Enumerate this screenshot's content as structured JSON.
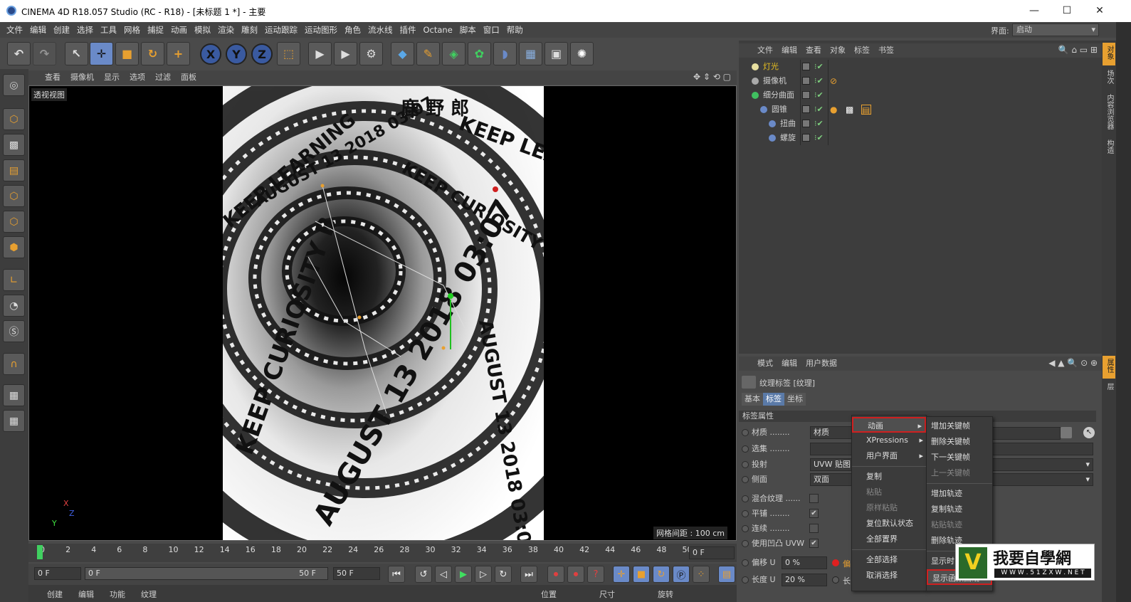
{
  "window": {
    "title": "CINEMA 4D R18.057 Studio (RC - R18) - [未标题 1 *] - 主要",
    "minimize": "—",
    "maximize": "☐",
    "close": "✕"
  },
  "menu": [
    "文件",
    "编辑",
    "创建",
    "选择",
    "工具",
    "网格",
    "捕捉",
    "动画",
    "模拟",
    "渲染",
    "雕刻",
    "运动跟踪",
    "运动图形",
    "角色",
    "流水线",
    "插件",
    "Octane",
    "脚本",
    "窗口",
    "帮助"
  ],
  "layout": {
    "label": "界面:",
    "value": "启动"
  },
  "toolbar": {
    "x": "X",
    "y": "Y",
    "z": "Z"
  },
  "viewport": {
    "menu": [
      "查看",
      "摄像机",
      "显示",
      "选项",
      "过滤",
      "面板"
    ],
    "label": "透视视图",
    "grid": "网格间距 : 100 cm",
    "axis": {
      "x": "X",
      "y": "Y",
      "z": "Z"
    }
  },
  "scene_text": {
    "lines": [
      "KEEP LEARNING",
      "AUGUST 13 2018 03:07",
      "KEEP CURIOSITY B",
      "鹿 野 郎",
      "馬 野"
    ]
  },
  "timeline": {
    "ticks": [
      "0",
      "2",
      "4",
      "6",
      "8",
      "10",
      "12",
      "14",
      "16",
      "18",
      "20",
      "22",
      "24",
      "26",
      "28",
      "30",
      "32",
      "34",
      "36",
      "38",
      "40",
      "42",
      "44",
      "46",
      "48",
      "50"
    ],
    "end_field": "0 F"
  },
  "playback": {
    "start": "0 F",
    "range_start": "0 F",
    "range_end": "50 F",
    "end": "50 F"
  },
  "bottom_left": [
    "创建",
    "编辑",
    "功能",
    "纹理"
  ],
  "bottom_mid": [
    "位置",
    "尺寸",
    "旋转"
  ],
  "objects": {
    "menu": [
      "文件",
      "编辑",
      "查看",
      "对象",
      "标签",
      "书签"
    ],
    "rows": [
      {
        "name": "灯光",
        "color": "#e8c020",
        "indent": 0
      },
      {
        "name": "摄像机",
        "color": "#d0d0d0",
        "indent": 0
      },
      {
        "name": "细分曲面",
        "color": "#d0d0d0",
        "indent": 0
      },
      {
        "name": "圆锥",
        "color": "#d0d0d0",
        "indent": 1
      },
      {
        "name": "扭曲",
        "color": "#d0d0d0",
        "indent": 2
      },
      {
        "name": "螺旋",
        "color": "#d0d0d0",
        "indent": 2
      }
    ]
  },
  "attributes": {
    "menu": [
      "模式",
      "编辑",
      "用户数据"
    ],
    "title": "纹理标签 [纹理]",
    "tabs": [
      "基本",
      "标签",
      "坐标"
    ],
    "section": "标签属性",
    "props": [
      {
        "label": "材质 ........",
        "value": "材质"
      },
      {
        "label": "选集 ........",
        "value": ""
      },
      {
        "label": "投射",
        "value": "UVW 贴图"
      },
      {
        "label": "侧面",
        "value": "双面"
      },
      {
        "label": "混合纹理 ......",
        "value": ""
      },
      {
        "label": "平铺 ........",
        "value": "✔"
      },
      {
        "label": "连续 ........",
        "value": ""
      },
      {
        "label": "使用凹凸 UVW",
        "value": "✔"
      },
      {
        "label": "偏移 U",
        "value": "0 %"
      },
      {
        "label": "长度 U",
        "value": "20 %"
      }
    ],
    "extra_labels": [
      "偏",
      "长"
    ]
  },
  "context_menu": {
    "main": [
      {
        "label": "动画",
        "arrow": "▸",
        "disabled": false,
        "highlight": true
      },
      {
        "label": "XPressions",
        "arrow": "▸",
        "disabled": false
      },
      {
        "label": "用户界面",
        "arrow": "▸",
        "disabled": false
      },
      {
        "sep": true
      },
      {
        "label": "复制",
        "disabled": false
      },
      {
        "label": "粘贴",
        "disabled": true
      },
      {
        "label": "原样粘贴",
        "disabled": true
      },
      {
        "label": "复位默认状态",
        "disabled": false
      },
      {
        "label": "全部置界",
        "disabled": false
      },
      {
        "sep": true
      },
      {
        "label": "全部选择",
        "disabled": false
      },
      {
        "label": "取消选择",
        "disabled": false
      }
    ],
    "sub": [
      {
        "label": "增加关键帧",
        "disabled": false
      },
      {
        "label": "删除关键帧",
        "disabled": false
      },
      {
        "label": "下一关键帧",
        "disabled": false
      },
      {
        "label": "上一关键帧",
        "disabled": true
      },
      {
        "sep": true
      },
      {
        "label": "增加轨迹",
        "disabled": false
      },
      {
        "label": "复制轨迹",
        "disabled": false
      },
      {
        "label": "粘贴轨迹",
        "disabled": true
      },
      {
        "label": "删除轨迹",
        "disabled": false
      },
      {
        "sep": true
      },
      {
        "label": "显示时",
        "disabled": false
      },
      {
        "label": "显示函数曲线",
        "disabled": false,
        "highlight": true
      }
    ]
  },
  "right_tabs_top": [
    "对象",
    "场次",
    "内容浏览器",
    "构造"
  ],
  "right_tabs_bottom": [
    "属性",
    "层"
  ],
  "watermark": {
    "main": "我要自學網",
    "url": "W W W . 5 1 Z X W . N E T",
    "logo": "V"
  }
}
